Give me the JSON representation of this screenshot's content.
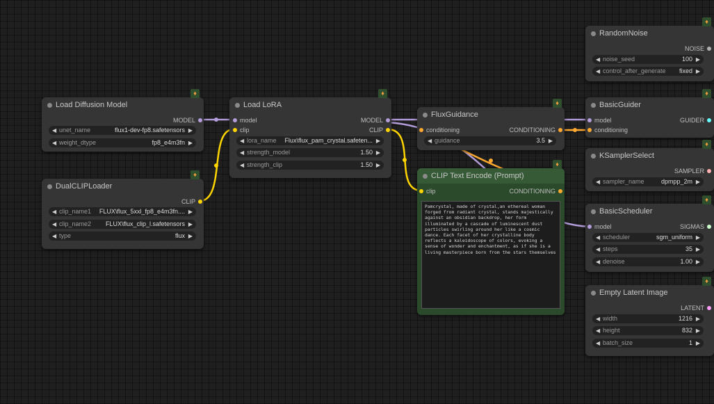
{
  "colors": {
    "model": "#b39ddb",
    "clip": "#ffd500",
    "conditioning": "#ffa931",
    "noise": "#b0b0b0",
    "guider": "#66ffff",
    "sampler": "#ffb0b0",
    "sigmas": "#cdffcd",
    "latent": "#ff9cf9",
    "clip_node_bg": "#2b4a2b"
  },
  "nodes": {
    "load_diffusion": {
      "title": "Load Diffusion Model",
      "out_model": "MODEL",
      "w1_label": "unet_name",
      "w1_value": "flux1-dev-fp8.safetensors",
      "w2_label": "weight_dtype",
      "w2_value": "fp8_e4m3fn"
    },
    "dual_clip": {
      "title": "DualCLIPLoader",
      "out_clip": "CLIP",
      "w1_label": "clip_name1",
      "w1_value": "FLUX\\flux_5xxl_fp8_e4m3fn....",
      "w2_label": "clip_name2",
      "w2_value": "FLUX\\flux_clip_l.safetensors",
      "w3_label": "type",
      "w3_value": "flux"
    },
    "load_lora": {
      "title": "Load LoRA",
      "in_model": "model",
      "in_clip": "clip",
      "out_model": "MODEL",
      "out_clip": "CLIP",
      "w1_label": "lora_name",
      "w1_value": "Flux\\flux_pam_crystal.safeten...",
      "w2_label": "strength_model",
      "w2_value": "1.50",
      "w3_label": "strength_clip",
      "w3_value": "1.50"
    },
    "flux_guidance": {
      "title": "FluxGuidance",
      "in_cond": "conditioning",
      "out_cond": "CONDITIONING",
      "w1_label": "guidance",
      "w1_value": "3.5"
    },
    "clip_text": {
      "title": "CLIP Text Encode (Prompt)",
      "in_clip": "clip",
      "out_cond": "CONDITIONING",
      "prompt": "Pamcrystal, made of crystal,an ethereal woman forged from radiant crystal, stands majestically against an obsidian backdrop, her form illuminated by a cascade of luminescent dust particles swirling around her like a cosmic dance. Each facet of her crystalline body reflects a kaleidoscope of colors, evoking a sense of wonder and enchantment, as if she is a living masterpiece born from the stars themselves"
    },
    "random_noise": {
      "title": "RandomNoise",
      "out_noise": "NOISE",
      "w1_label": "noise_seed",
      "w1_value": "100",
      "w2_label": "control_after_generate",
      "w2_value": "fixed"
    },
    "basic_guider": {
      "title": "BasicGuider",
      "in_model": "model",
      "in_cond": "conditioning",
      "out_guider": "GUIDER"
    },
    "ksampler_select": {
      "title": "KSamplerSelect",
      "out_sampler": "SAMPLER",
      "w1_label": "sampler_name",
      "w1_value": "dpmpp_2m"
    },
    "basic_scheduler": {
      "title": "BasicScheduler",
      "in_model": "model",
      "out_sigmas": "SIGMAS",
      "w1_label": "scheduler",
      "w1_value": "sgm_uniform",
      "w2_label": "steps",
      "w2_value": "35",
      "w3_label": "denoise",
      "w3_value": "1.00"
    },
    "empty_latent": {
      "title": "Empty Latent Image",
      "out_latent": "LATENT",
      "w1_label": "width",
      "w1_value": "1216",
      "w2_label": "height",
      "w2_value": "832",
      "w3_label": "batch_size",
      "w3_value": "1"
    }
  }
}
